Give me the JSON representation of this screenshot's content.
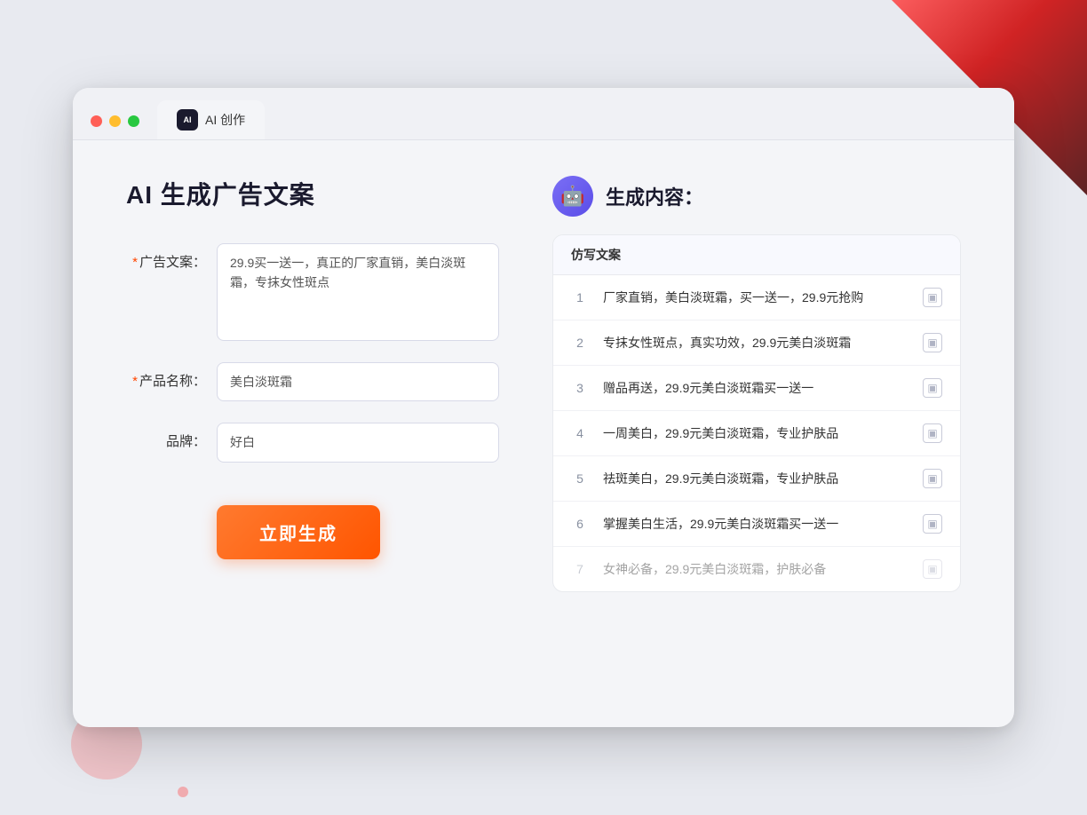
{
  "browser": {
    "tab_label": "AI 创作"
  },
  "page": {
    "title": "AI 生成广告文案"
  },
  "form": {
    "ad_copy_label": "广告文案：",
    "ad_copy_required": "*",
    "ad_copy_value": "29.9买一送一，真正的厂家直销，美白淡斑霜，专抹女性斑点",
    "product_name_label": "产品名称：",
    "product_name_required": "*",
    "product_name_value": "美白淡斑霜",
    "brand_label": "品牌：",
    "brand_value": "好白",
    "generate_button": "立即生成"
  },
  "results": {
    "header_icon": "robot",
    "header_title": "生成内容：",
    "column_label": "仿写文案",
    "items": [
      {
        "num": "1",
        "text": "厂家直销，美白淡斑霜，买一送一，29.9元抢购"
      },
      {
        "num": "2",
        "text": "专抹女性斑点，真实功效，29.9元美白淡斑霜"
      },
      {
        "num": "3",
        "text": "赠品再送，29.9元美白淡斑霜买一送一"
      },
      {
        "num": "4",
        "text": "一周美白，29.9元美白淡斑霜，专业护肤品"
      },
      {
        "num": "5",
        "text": "祛斑美白，29.9元美白淡斑霜，专业护肤品"
      },
      {
        "num": "6",
        "text": "掌握美白生活，29.9元美白淡斑霜买一送一"
      },
      {
        "num": "7",
        "text": "女神必备，29.9元美白淡斑霜，护肤必备",
        "faded": true
      }
    ]
  },
  "colors": {
    "accent_orange": "#ff6030",
    "accent_purple": "#6b5ef5"
  }
}
